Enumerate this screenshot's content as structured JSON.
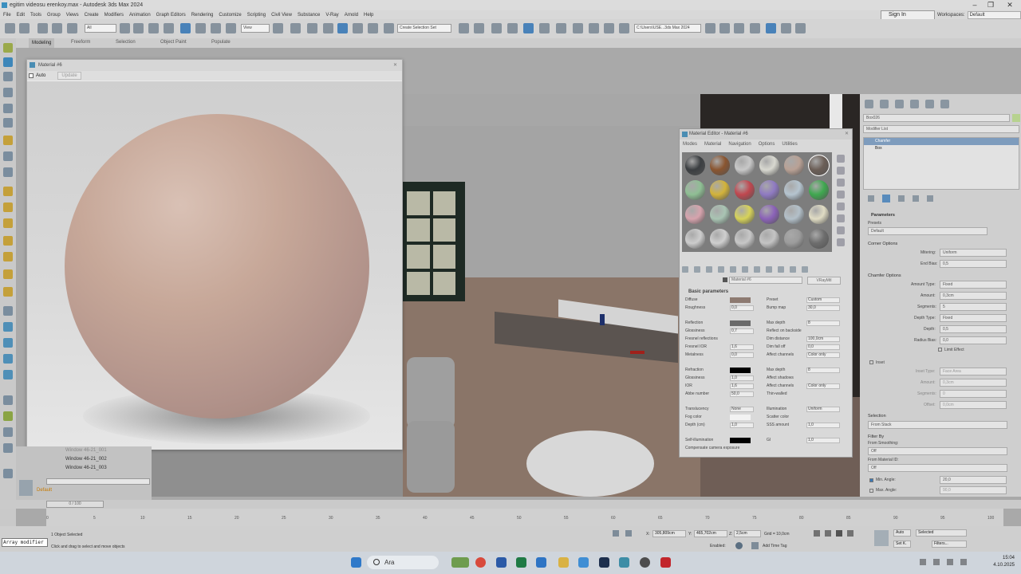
{
  "window": {
    "title": "egitim videosu erenkoy.max - Autodesk 3ds Max 2024"
  },
  "menu": [
    "File",
    "Edit",
    "Tools",
    "Group",
    "Views",
    "Create",
    "Modifiers",
    "Animation",
    "Graph Editors",
    "Rendering",
    "Customize",
    "Scripting",
    "Civil View",
    "Substance",
    "V-Ray",
    "Arnold",
    "Help"
  ],
  "account": {
    "sign_in": "Sign In",
    "workspaces_label": "Workspaces:",
    "workspace": "Default"
  },
  "toolbar": {
    "selection_filter": "All",
    "ref_coord": "View",
    "named_selection": "Create Selection Set",
    "project_path": "C:\\Users\\USE...3ds Max 2024"
  },
  "ribbon": {
    "tabs": [
      "Modeling",
      "Freeform",
      "Selection",
      "Object Paint",
      "Populate"
    ]
  },
  "material_preview": {
    "title": "Material #6",
    "auto_label": "Auto",
    "update_label": "Update"
  },
  "material_editor": {
    "title": "Material Editor - Material #6",
    "menus": [
      "Modes",
      "Material",
      "Navigation",
      "Options",
      "Utilities"
    ],
    "material_name": "Material #6",
    "material_type": "VRayMtl",
    "rollout_title": "Basic parameters",
    "slot_colors": [
      "#3b3e41",
      "#8a5530",
      "#c8c8c8",
      "#d8d8d0",
      "#b9a195",
      "#6b5e56",
      "#8fbf94",
      "#d3b33a",
      "#c0474f",
      "#8f7ac2",
      "#b5c4cf",
      "#3fa84f",
      "#d6a3ad",
      "#a9c4b3",
      "#d6d259",
      "#8b62b8",
      "#b3c0c9",
      "#e0dcc4",
      "#cdcdcd",
      "#cfcfcf",
      "#c7c7c7",
      "#c4c4c4",
      "#9c9c9c",
      "#6d6d6d"
    ],
    "params": [
      {
        "l": "Diffuse",
        "v": "",
        "sw": "#8d7a71",
        "l2": "Preset",
        "v2": "Custom"
      },
      {
        "l": "Roughness",
        "v": "0,0",
        "l2": "Bump map",
        "v2": "30,0"
      },
      {
        "l": "",
        "v": "",
        "l2": "",
        "v2": ""
      },
      {
        "l": "Reflection",
        "v": "",
        "sw": "#6a6a6a",
        "l2": "Max depth",
        "v2": "8"
      },
      {
        "l": "Glossiness",
        "v": "0,7",
        "l2": "Reflect on backside",
        "v2": ""
      },
      {
        "l": "Fresnel reflections",
        "v": "",
        "l2": "Dim distance",
        "v2": "100,0cm"
      },
      {
        "l": "Fresnel IOR",
        "v": "1,6",
        "l2": "Dim fall off",
        "v2": "0,0"
      },
      {
        "l": "Metalness",
        "v": "0,0",
        "l2": "Affect channels",
        "v2": "Color only"
      },
      {
        "l": "",
        "v": "",
        "l2": "",
        "v2": ""
      },
      {
        "l": "Refraction",
        "v": "",
        "sw": "#000000",
        "l2": "Max depth",
        "v2": "8"
      },
      {
        "l": "Glossiness",
        "v": "1,0",
        "l2": "Affect shadows",
        "v2": ""
      },
      {
        "l": "IOR",
        "v": "1,6",
        "l2": "Affect channels",
        "v2": "Color only"
      },
      {
        "l": "Abbe number",
        "v": "50,0",
        "l2": "Thin-walled",
        "v2": ""
      },
      {
        "l": "",
        "v": "",
        "l2": "",
        "v2": ""
      },
      {
        "l": "Translucency",
        "v": "None",
        "l2": "Illumination",
        "v2": "Uniform"
      },
      {
        "l": "Fog color",
        "v": "",
        "sw": "#f2f2f2",
        "l2": "Scatter color",
        "v2": ""
      },
      {
        "l": "Depth (cm)",
        "v": "1,0",
        "l2": "SSS amount",
        "v2": "1,0"
      },
      {
        "l": "",
        "v": "",
        "l2": "",
        "v2": ""
      },
      {
        "l": "Self-illumination",
        "v": "",
        "sw": "#000000",
        "l2": "GI",
        "v2": "1,0"
      },
      {
        "l": "Compensate camera exposure",
        "v": "",
        "l2": "",
        "v2": ""
      }
    ]
  },
  "command_panel": {
    "object_name": "Box026",
    "modifier_list": "Modifier List",
    "stack": [
      "Chamfer",
      "Box"
    ],
    "parameters": "Parameters",
    "presets_label": "Presets",
    "presets_value": "Default",
    "corner_options": "Corner Options",
    "mitering_label": "Mitering:",
    "mitering": "Uniform",
    "end_bias_label": "End Bias:",
    "end_bias": "0,5",
    "chamfer_options": "Chamfer Options",
    "amount_type_label": "Amount Type:",
    "amount_type": "Fixed",
    "amount_label": "Amount:",
    "amount": "0,3cm",
    "segments_label": "Segments:",
    "segments": "5",
    "depth_type_label": "Depth Type:",
    "depth_type": "Fixed",
    "depth_label": "Depth:",
    "depth": "0,5",
    "radius_bias_label": "Radius Bias:",
    "radius_bias": "0,0",
    "limit_effect": "Limit Effect",
    "inset": "Inset",
    "inset_type_label": "Inset Type:",
    "inset_type": "Face Area",
    "inset_amount_label": "Amount:",
    "inset_amount": "0,3cm",
    "inset_segments_label": "Segments:",
    "inset_segments": "0",
    "offset_label": "Offset:",
    "offset": "0,0cm",
    "selection": "Selection",
    "selection_value": "From Stack",
    "filter_by": "Filter By",
    "from_smoothing": "From Smoothing:",
    "from_smoothing_value": "Off",
    "from_material": "From Material ID:",
    "from_material_value": "Off",
    "min_angle": "Min. Angle:",
    "min_angle_value": "20,0",
    "max_angle": "Max. Angle:",
    "max_angle_value": "90,0"
  },
  "explorer": {
    "rows": [
      "Window 46-21_001",
      "Window 46-21_002",
      "Window 46-21_003"
    ],
    "layer": "Default"
  },
  "timeline": {
    "slider": "0 / 100",
    "ticks": [
      "0",
      "5",
      "10",
      "15",
      "20",
      "25",
      "30",
      "35",
      "40",
      "45",
      "50",
      "55",
      "60",
      "65",
      "70",
      "75",
      "80",
      "85",
      "90",
      "95",
      "100"
    ]
  },
  "status": {
    "maxscript": "Array modifier",
    "selected": "1 Object Selected",
    "prompt": "Click and drag to select and move objects",
    "x": "305,809cm",
    "y": "465,702cm",
    "z": "2,5cm",
    "grid": "Grid = 10,0cm",
    "enabled": "Enabled:",
    "add_time_tag": "Add Time Tag",
    "auto": "Auto",
    "selected_dropdown": "Selected",
    "set_k": "Set K.",
    "filters": "Filters..."
  },
  "taskbar": {
    "search": "Ara",
    "time": "15:04",
    "date": "4.10.2025"
  }
}
